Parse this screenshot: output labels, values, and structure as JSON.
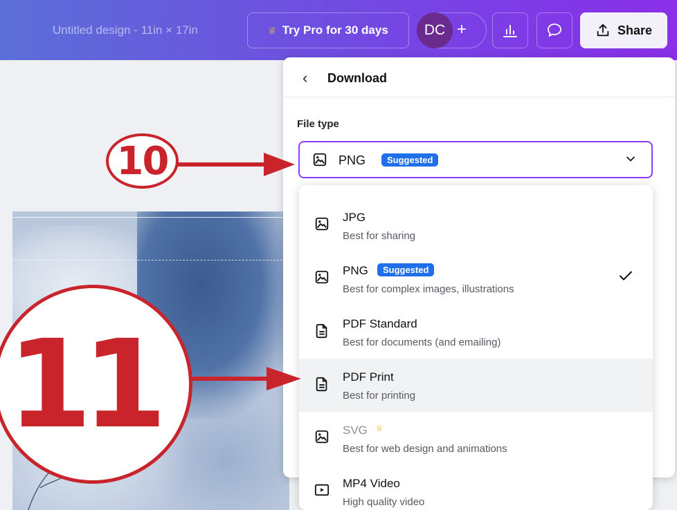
{
  "header": {
    "doc_title": "Untitled design - 11in × 17in",
    "try_pro_label": "Try Pro for 30 days",
    "avatar_initials": "DC",
    "share_label": "Share"
  },
  "download_panel": {
    "title": "Download",
    "file_type_label": "File type",
    "selected": {
      "name": "PNG",
      "badge": "Suggested"
    },
    "options": [
      {
        "name": "JPG",
        "badge": "",
        "description": "Best for sharing",
        "icon": "image-icon",
        "pro": false,
        "selected": false,
        "highlighted": false
      },
      {
        "name": "PNG",
        "badge": "Suggested",
        "description": "Best for complex images, illustrations",
        "icon": "image-icon",
        "pro": false,
        "selected": true,
        "highlighted": false
      },
      {
        "name": "PDF Standard",
        "badge": "",
        "description": "Best for documents (and emailing)",
        "icon": "document-icon",
        "pro": false,
        "selected": false,
        "highlighted": false
      },
      {
        "name": "PDF Print",
        "badge": "",
        "description": "Best for printing",
        "icon": "document-icon",
        "pro": false,
        "selected": false,
        "highlighted": true
      },
      {
        "name": "SVG",
        "badge": "",
        "description": "Best for web design and animations",
        "icon": "image-icon",
        "pro": true,
        "selected": false,
        "highlighted": false
      },
      {
        "name": "MP4 Video",
        "badge": "",
        "description": "High quality video",
        "icon": "video-icon",
        "pro": false,
        "selected": false,
        "highlighted": false
      }
    ]
  },
  "annotations": {
    "step_a": "10",
    "step_b": "11"
  },
  "colors": {
    "accent_purple": "#8b3dff",
    "badge_blue": "#1f6fe8",
    "annotation_red": "#c9242c",
    "pro_crown": "#f2b924"
  }
}
